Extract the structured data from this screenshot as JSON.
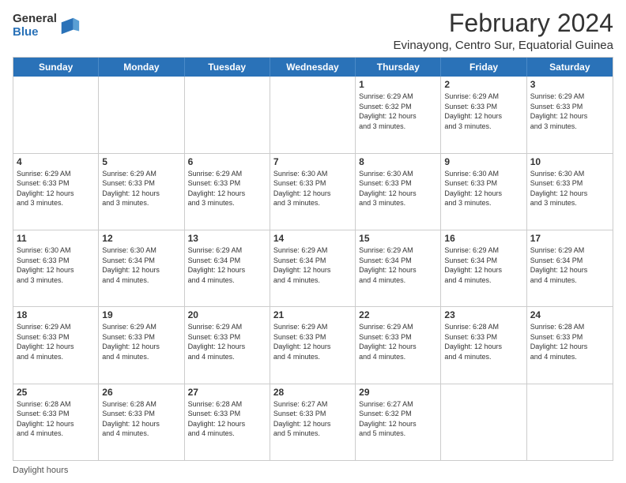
{
  "logo": {
    "general": "General",
    "blue": "Blue"
  },
  "title": {
    "month_year": "February 2024",
    "location": "Evinayong, Centro Sur, Equatorial Guinea"
  },
  "calendar": {
    "headers": [
      "Sunday",
      "Monday",
      "Tuesday",
      "Wednesday",
      "Thursday",
      "Friday",
      "Saturday"
    ],
    "weeks": [
      [
        {
          "day": "",
          "info": ""
        },
        {
          "day": "",
          "info": ""
        },
        {
          "day": "",
          "info": ""
        },
        {
          "day": "",
          "info": ""
        },
        {
          "day": "1",
          "info": "Sunrise: 6:29 AM\nSunset: 6:32 PM\nDaylight: 12 hours\nand 3 minutes."
        },
        {
          "day": "2",
          "info": "Sunrise: 6:29 AM\nSunset: 6:33 PM\nDaylight: 12 hours\nand 3 minutes."
        },
        {
          "day": "3",
          "info": "Sunrise: 6:29 AM\nSunset: 6:33 PM\nDaylight: 12 hours\nand 3 minutes."
        }
      ],
      [
        {
          "day": "4",
          "info": "Sunrise: 6:29 AM\nSunset: 6:33 PM\nDaylight: 12 hours\nand 3 minutes."
        },
        {
          "day": "5",
          "info": "Sunrise: 6:29 AM\nSunset: 6:33 PM\nDaylight: 12 hours\nand 3 minutes."
        },
        {
          "day": "6",
          "info": "Sunrise: 6:29 AM\nSunset: 6:33 PM\nDaylight: 12 hours\nand 3 minutes."
        },
        {
          "day": "7",
          "info": "Sunrise: 6:30 AM\nSunset: 6:33 PM\nDaylight: 12 hours\nand 3 minutes."
        },
        {
          "day": "8",
          "info": "Sunrise: 6:30 AM\nSunset: 6:33 PM\nDaylight: 12 hours\nand 3 minutes."
        },
        {
          "day": "9",
          "info": "Sunrise: 6:30 AM\nSunset: 6:33 PM\nDaylight: 12 hours\nand 3 minutes."
        },
        {
          "day": "10",
          "info": "Sunrise: 6:30 AM\nSunset: 6:33 PM\nDaylight: 12 hours\nand 3 minutes."
        }
      ],
      [
        {
          "day": "11",
          "info": "Sunrise: 6:30 AM\nSunset: 6:33 PM\nDaylight: 12 hours\nand 3 minutes."
        },
        {
          "day": "12",
          "info": "Sunrise: 6:30 AM\nSunset: 6:34 PM\nDaylight: 12 hours\nand 4 minutes."
        },
        {
          "day": "13",
          "info": "Sunrise: 6:29 AM\nSunset: 6:34 PM\nDaylight: 12 hours\nand 4 minutes."
        },
        {
          "day": "14",
          "info": "Sunrise: 6:29 AM\nSunset: 6:34 PM\nDaylight: 12 hours\nand 4 minutes."
        },
        {
          "day": "15",
          "info": "Sunrise: 6:29 AM\nSunset: 6:34 PM\nDaylight: 12 hours\nand 4 minutes."
        },
        {
          "day": "16",
          "info": "Sunrise: 6:29 AM\nSunset: 6:34 PM\nDaylight: 12 hours\nand 4 minutes."
        },
        {
          "day": "17",
          "info": "Sunrise: 6:29 AM\nSunset: 6:34 PM\nDaylight: 12 hours\nand 4 minutes."
        }
      ],
      [
        {
          "day": "18",
          "info": "Sunrise: 6:29 AM\nSunset: 6:33 PM\nDaylight: 12 hours\nand 4 minutes."
        },
        {
          "day": "19",
          "info": "Sunrise: 6:29 AM\nSunset: 6:33 PM\nDaylight: 12 hours\nand 4 minutes."
        },
        {
          "day": "20",
          "info": "Sunrise: 6:29 AM\nSunset: 6:33 PM\nDaylight: 12 hours\nand 4 minutes."
        },
        {
          "day": "21",
          "info": "Sunrise: 6:29 AM\nSunset: 6:33 PM\nDaylight: 12 hours\nand 4 minutes."
        },
        {
          "day": "22",
          "info": "Sunrise: 6:29 AM\nSunset: 6:33 PM\nDaylight: 12 hours\nand 4 minutes."
        },
        {
          "day": "23",
          "info": "Sunrise: 6:28 AM\nSunset: 6:33 PM\nDaylight: 12 hours\nand 4 minutes."
        },
        {
          "day": "24",
          "info": "Sunrise: 6:28 AM\nSunset: 6:33 PM\nDaylight: 12 hours\nand 4 minutes."
        }
      ],
      [
        {
          "day": "25",
          "info": "Sunrise: 6:28 AM\nSunset: 6:33 PM\nDaylight: 12 hours\nand 4 minutes."
        },
        {
          "day": "26",
          "info": "Sunrise: 6:28 AM\nSunset: 6:33 PM\nDaylight: 12 hours\nand 4 minutes."
        },
        {
          "day": "27",
          "info": "Sunrise: 6:28 AM\nSunset: 6:33 PM\nDaylight: 12 hours\nand 4 minutes."
        },
        {
          "day": "28",
          "info": "Sunrise: 6:27 AM\nSunset: 6:33 PM\nDaylight: 12 hours\nand 5 minutes."
        },
        {
          "day": "29",
          "info": "Sunrise: 6:27 AM\nSunset: 6:32 PM\nDaylight: 12 hours\nand 5 minutes."
        },
        {
          "day": "",
          "info": ""
        },
        {
          "day": "",
          "info": ""
        }
      ]
    ]
  },
  "footer": {
    "daylight_hours": "Daylight hours"
  }
}
